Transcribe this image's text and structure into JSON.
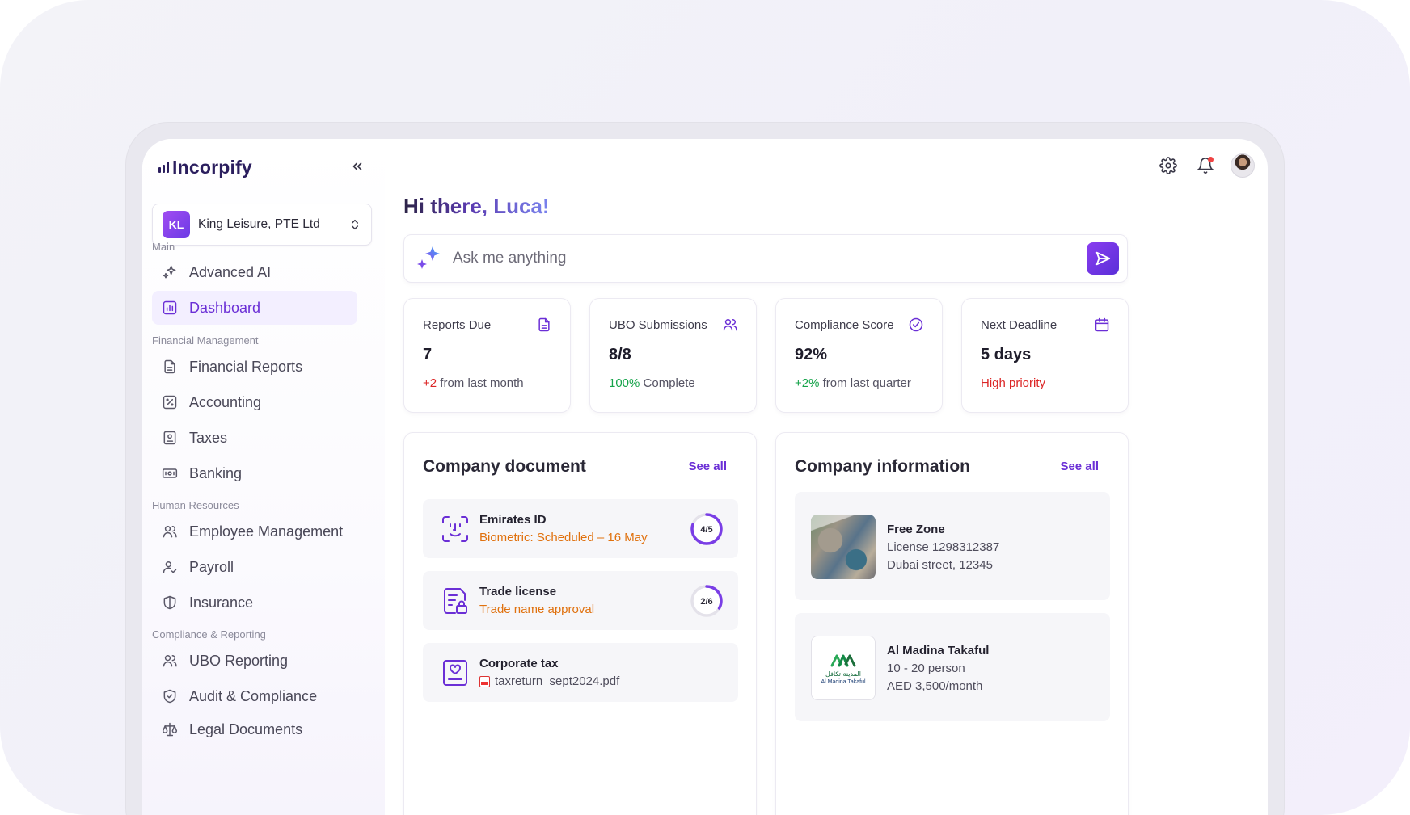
{
  "brand": {
    "name": "Incorpify"
  },
  "company_selector": {
    "initials": "KL",
    "name": "King Leisure, PTE Ltd"
  },
  "nav": {
    "sections": [
      {
        "label": "Main"
      },
      {
        "label": "Financial Management"
      },
      {
        "label": "Human Resources"
      },
      {
        "label": "Compliance & Reporting"
      }
    ],
    "items": [
      {
        "label": "Advanced AI",
        "icon": "sparkles-icon"
      },
      {
        "label": "Dashboard",
        "icon": "bar-chart-icon",
        "active": true
      },
      {
        "label": "Financial Reports",
        "icon": "file-text-icon"
      },
      {
        "label": "Accounting",
        "icon": "percent-icon"
      },
      {
        "label": "Taxes",
        "icon": "receipt-icon"
      },
      {
        "label": "Banking",
        "icon": "banknote-icon"
      },
      {
        "label": "Employee Management",
        "icon": "users-icon"
      },
      {
        "label": "Payroll",
        "icon": "user-check-icon"
      },
      {
        "label": "Insurance",
        "icon": "shield-icon"
      },
      {
        "label": "UBO Reporting",
        "icon": "users-icon"
      },
      {
        "label": "Audit & Compliance",
        "icon": "shield-check-icon"
      },
      {
        "label": "Legal Documents",
        "icon": "scale-icon"
      }
    ]
  },
  "header": {
    "greeting": "Hi there, Luca!"
  },
  "ask": {
    "placeholder": "Ask me anything"
  },
  "stats": [
    {
      "title": "Reports Due",
      "value": "7",
      "delta": "+2",
      "delta_text": " from last month",
      "delta_color": "#dc2626",
      "icon": "file-icon"
    },
    {
      "title": "UBO Submissions",
      "value": "8/8",
      "delta": "100%",
      "delta_text": " Complete",
      "delta_color": "#16a34a",
      "icon": "users-icon"
    },
    {
      "title": "Compliance Score",
      "value": "92%",
      "delta": "+2%",
      "delta_text": " from last quarter",
      "delta_color": "#16a34a",
      "icon": "check-circle-icon"
    },
    {
      "title": "Next Deadline",
      "value": "5 days",
      "delta": "High priority",
      "delta_text": "",
      "delta_color": "#dc2626",
      "icon": "calendar-icon"
    }
  ],
  "documents": {
    "title": "Company document",
    "see_all": "See all",
    "items": [
      {
        "name": "Emirates ID",
        "status": "Biometric: Scheduled – 16 May",
        "progress": "4/5",
        "progress_fraction": 0.8,
        "icon": "face-scan-icon"
      },
      {
        "name": "Trade license",
        "status": "Trade name approval",
        "progress": "2/6",
        "progress_fraction": 0.333,
        "icon": "license-lock-icon"
      },
      {
        "name": "Corporate tax",
        "file": "taxreturn_sept2024.pdf",
        "icon": "certificate-icon"
      }
    ]
  },
  "company_info": {
    "title": "Company information",
    "see_all": "See all",
    "items": [
      {
        "name": "Free Zone",
        "line1": "License 1298312387",
        "line2": "Dubai street, 12345"
      },
      {
        "name": "Al Madina Takaful",
        "line1": "10 - 20 person",
        "line2": "AED 3,500/month",
        "logo_text_ar": "المدينة تكافل",
        "logo_text_en": "Al Madina Takaful"
      }
    ]
  },
  "colors": {
    "accent": "#6b2fd6",
    "warning": "#e0710e",
    "success": "#16a34a",
    "danger": "#dc2626"
  }
}
